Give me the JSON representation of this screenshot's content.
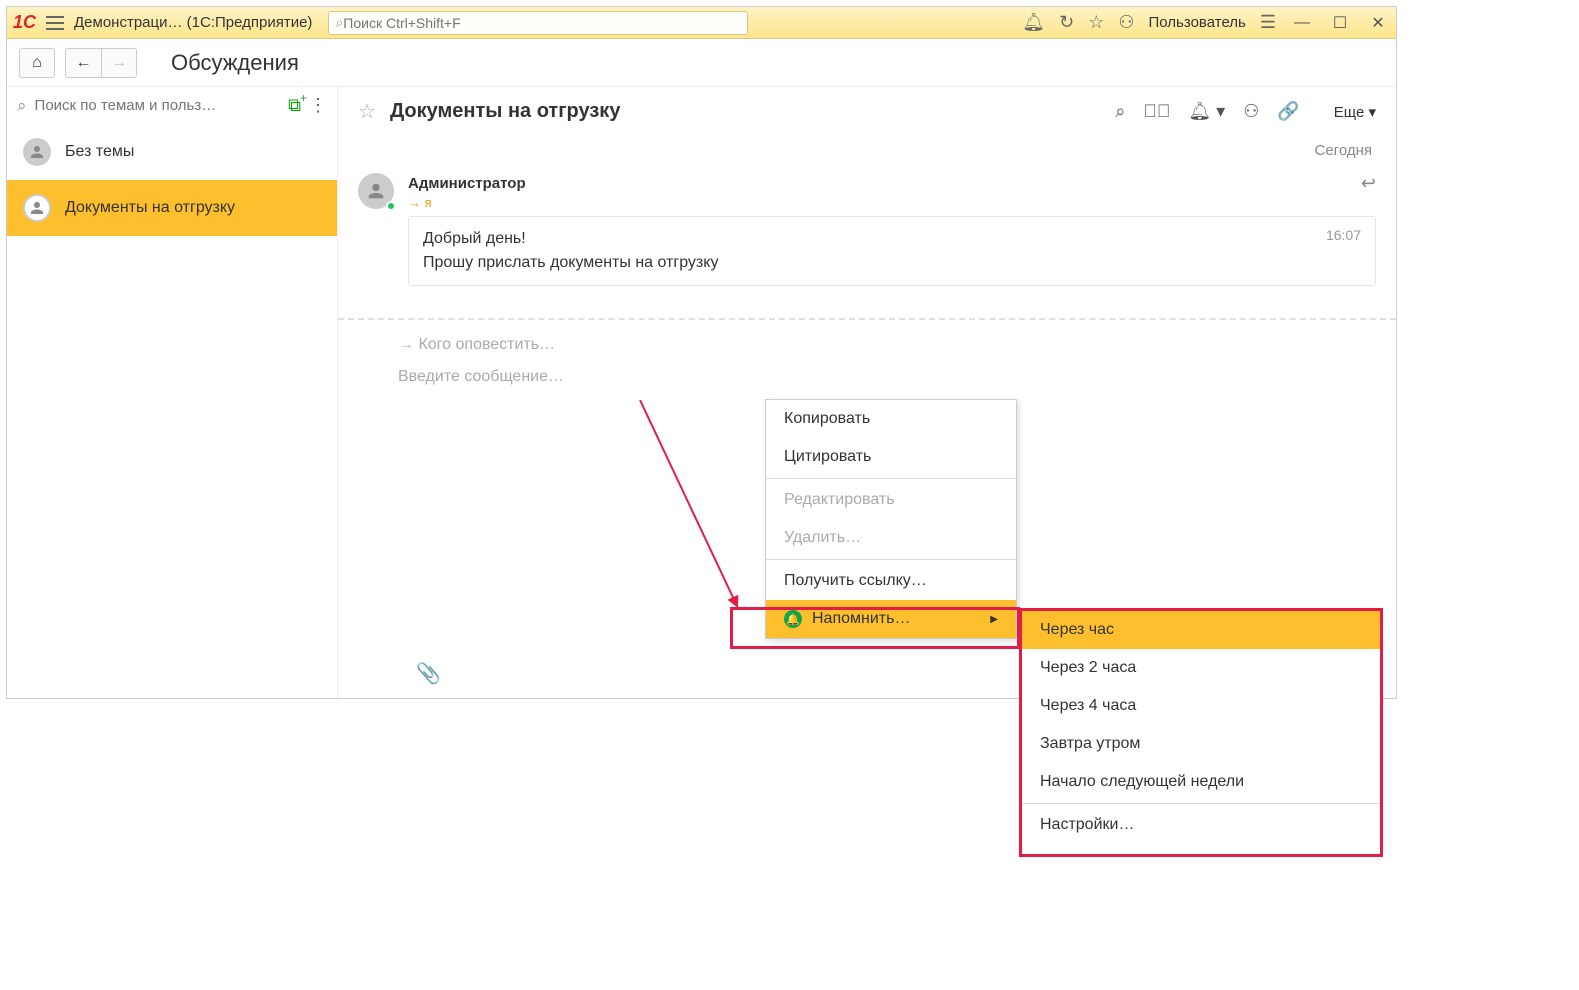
{
  "titlebar": {
    "app_title": "Демонстраци… (1С:Предприятие)",
    "search_placeholder": "Поиск Ctrl+Shift+F",
    "username": "Пользователь"
  },
  "navbar": {
    "page_title": "Обсуждения"
  },
  "sidebar": {
    "search_placeholder": "Поиск по темам и польз…",
    "items": [
      {
        "label": "Без темы"
      },
      {
        "label": "Документы на отгрузку"
      }
    ]
  },
  "main": {
    "topic_title": "Документы на отгрузку",
    "more_label": "Еще",
    "date_divider": "Сегодня",
    "message": {
      "author": "Администратор",
      "to": "→ я",
      "time": "16:07",
      "text": "Добрый день!\nПрошу прислать документы на отгрузку"
    },
    "input": {
      "notify_placeholder": "Кого оповестить…",
      "message_placeholder": "Введите сообщение…"
    }
  },
  "context_menu": {
    "copy": "Копировать",
    "quote": "Цитировать",
    "edit": "Редактировать",
    "delete": "Удалить…",
    "get_link": "Получить ссылку…",
    "remind": "Напомнить…"
  },
  "remind_submenu": {
    "hour": "Через час",
    "two_hours": "Через 2 часа",
    "four_hours": "Через 4 часа",
    "tomorrow": "Завтра утром",
    "next_week": "Начало следующей недели",
    "settings": "Настройки…"
  }
}
